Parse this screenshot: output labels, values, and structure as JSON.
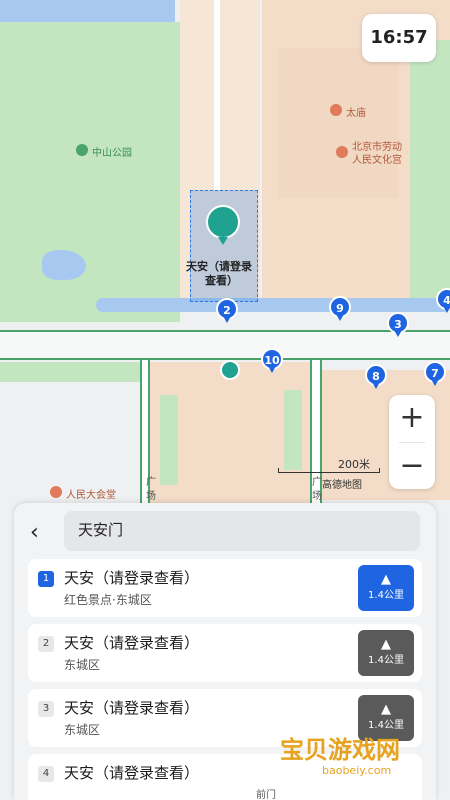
{
  "status": {
    "time": "16:57"
  },
  "map": {
    "pois": {
      "zhongshan_park": "中山公园",
      "taimiao": "太庙",
      "workers_palace_line1": "北京市劳动",
      "workers_palace_line2": "人民文化宫",
      "selected_label_line1": "天安（请登录",
      "selected_label_line2": "查看）",
      "great_hall": "人民大会堂",
      "square_left": "广场",
      "square_right": "广场",
      "qianmen": "前门"
    },
    "markers": [
      "1",
      "2",
      "9",
      "4",
      "3",
      "10",
      "8",
      "7"
    ],
    "scale_label": "200米",
    "brand": "高德地图",
    "zoom_in": "+",
    "zoom_out": "−",
    "colors": {
      "park": "#c3e6c1",
      "building": "#f3dcc8",
      "water": "#a8c9ef",
      "road_green": "#4aa36a",
      "accent": "#1f64e0"
    }
  },
  "panel": {
    "back_icon": "chevron-left-icon",
    "search_value": "天安门",
    "results": [
      {
        "index": "1",
        "title": "天安（请登录查看）",
        "subtitle": "红色景点·东城区",
        "distance": "1.4公里",
        "active": true
      },
      {
        "index": "2",
        "title": "天安（请登录查看）",
        "subtitle": "东城区",
        "distance": "1.4公里",
        "active": false
      },
      {
        "index": "3",
        "title": "天安（请登录查看）",
        "subtitle": "东城区",
        "distance": "1.4公里",
        "active": false
      },
      {
        "index": "4",
        "title": "天安（请登录查看）",
        "subtitle": "",
        "distance": "",
        "active": false
      }
    ]
  },
  "watermark": {
    "main": "宝贝游戏网",
    "url": "baobeiy.com"
  }
}
